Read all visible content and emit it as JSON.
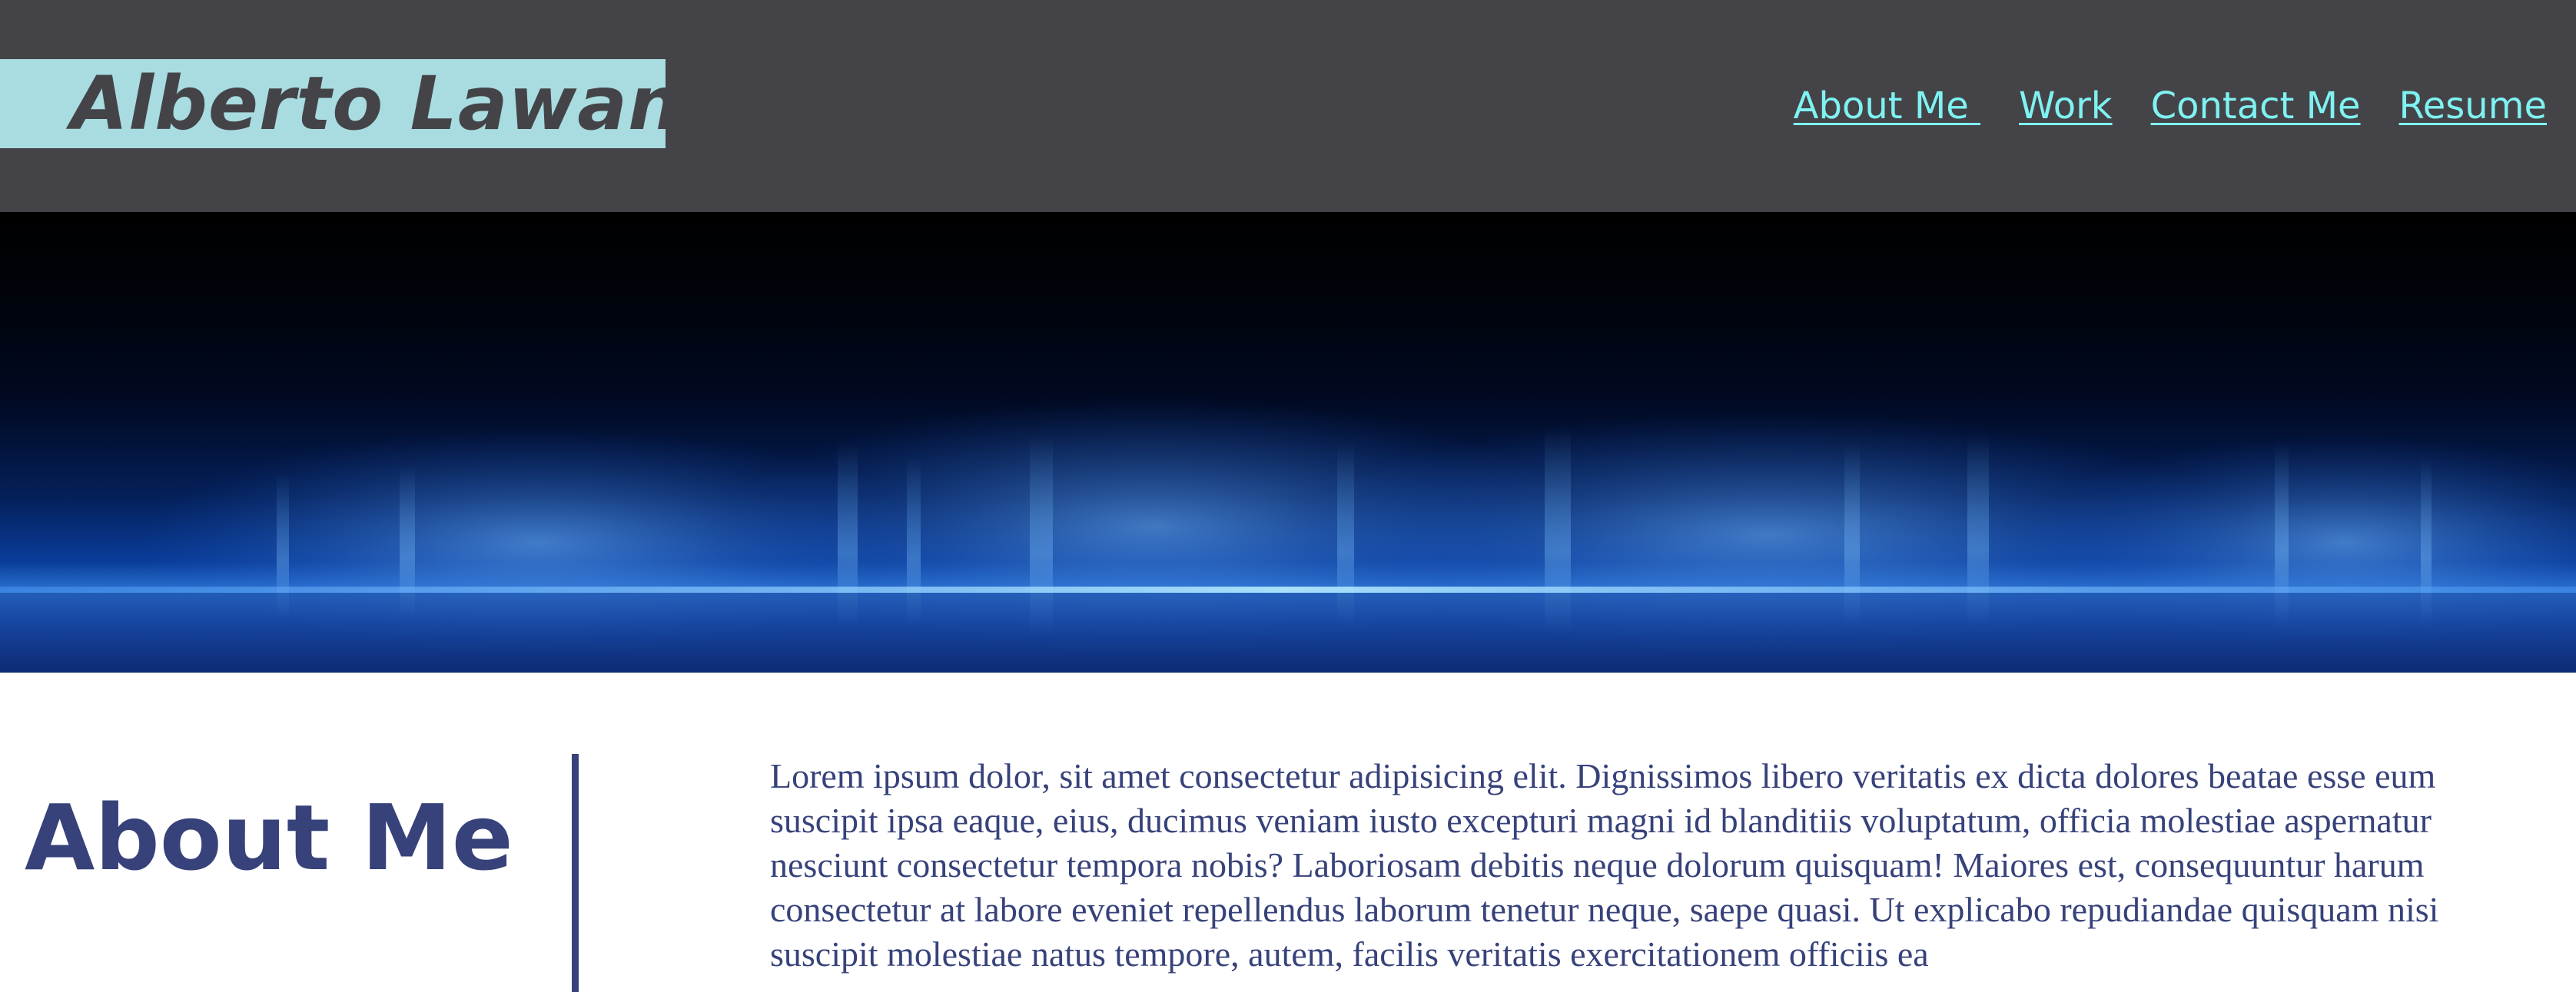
{
  "header": {
    "brand_name": "Alberto Lawant",
    "nav": [
      {
        "label": "About Me "
      },
      {
        "label": "Work"
      },
      {
        "label": "Contact Me"
      },
      {
        "label": "Resume"
      }
    ]
  },
  "about": {
    "title": "About Me",
    "body": "Lorem ipsum dolor, sit amet consectetur adipisicing elit. Dignissimos libero veritatis ex dicta dolores beatae esse eum suscipit ipsa eaque, eius, ducimus veniam iusto excepturi magni id blanditiis voluptatum, officia molestiae aspernatur nesciunt consectetur tempora nobis? Laboriosam debitis neque dolorum quisquam! Maiores est, consequuntur harum consectetur at labore eveniet repellendus laborum tenetur neque, saepe quasi. Ut explicabo repudiandae quisquam nisi suscipit molestiae natus tempore, autem, facilis veritatis exercitationem officiis ea"
  },
  "colors": {
    "header_bg": "#444448",
    "brand_bg": "#a8dce1",
    "nav_link": "#7ff2f2",
    "accent": "#37427a"
  }
}
